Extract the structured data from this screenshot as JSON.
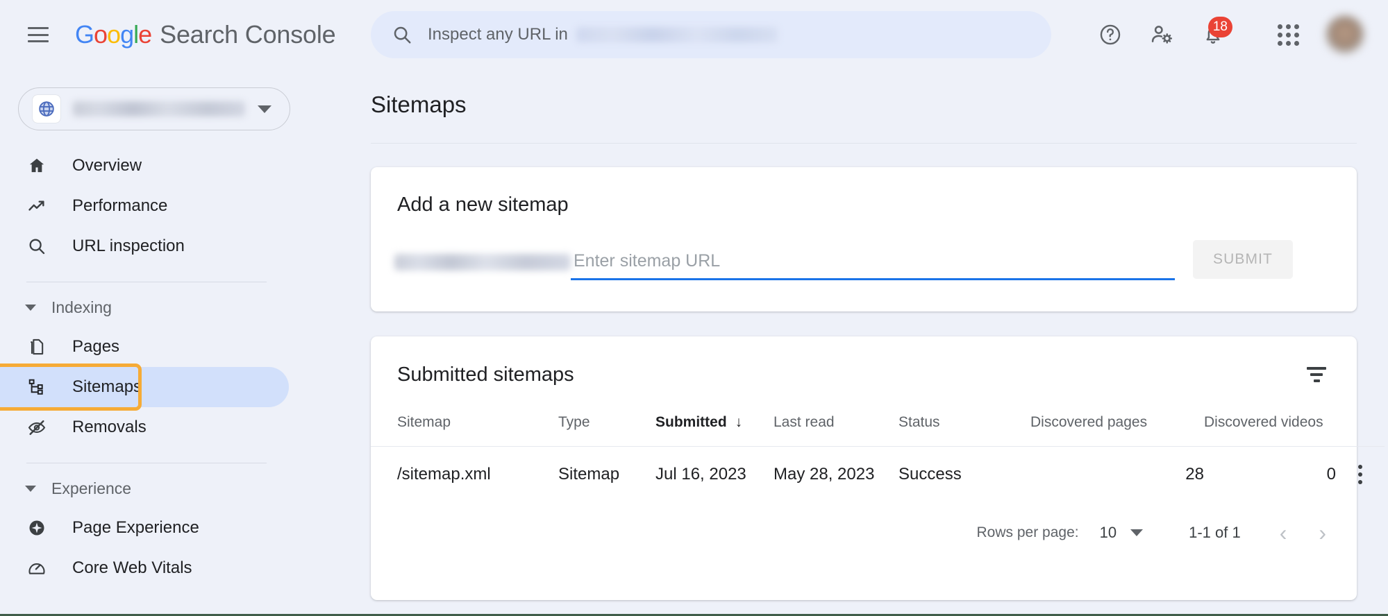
{
  "brand": {
    "logo_g1": "G",
    "logo_o1": "o",
    "logo_o2": "o",
    "logo_g2": "g",
    "logo_l": "l",
    "logo_e": "e",
    "product": "Search Console",
    "accent_blue": "#4285f4",
    "accent_red": "#ea4335",
    "accent_yellow": "#fbbc05",
    "accent_green": "#34a853"
  },
  "search": {
    "placeholder_prefix": "Inspect any URL in",
    "domain_redacted": true
  },
  "topbar_icons": {
    "help": "help-icon",
    "account_settings": "account-settings-icon",
    "notifications": "notifications-bell-icon",
    "notifications_count": "18",
    "apps": "apps-grid-icon",
    "avatar": "user-avatar"
  },
  "sidebar": {
    "property_selector": {
      "icon": "globe-icon",
      "value_redacted": true,
      "caret": "chevron-down-icon"
    },
    "primary_items": [
      {
        "label": "Overview",
        "icon": "home-icon"
      },
      {
        "label": "Performance",
        "icon": "trending-up-icon"
      },
      {
        "label": "URL inspection",
        "icon": "search-icon"
      }
    ],
    "sections": [
      {
        "label": "Indexing",
        "items": [
          {
            "label": "Pages",
            "icon": "pages-copy-icon",
            "selected": false
          },
          {
            "label": "Sitemaps",
            "icon": "sitemap-tree-icon",
            "selected": true,
            "highlighted": true
          },
          {
            "label": "Removals",
            "icon": "eye-off-icon",
            "selected": false
          }
        ]
      },
      {
        "label": "Experience",
        "items": [
          {
            "label": "Page Experience",
            "icon": "page-experience-icon",
            "selected": false
          },
          {
            "label": "Core Web Vitals",
            "icon": "speedometer-icon",
            "selected": false
          }
        ]
      }
    ],
    "highlight_color": "#f6ab36",
    "selected_bg": "#d2e0fb"
  },
  "main": {
    "page_title": "Sitemaps",
    "add_card": {
      "title": "Add a new sitemap",
      "url_prefix_redacted": true,
      "input_placeholder": "Enter sitemap URL",
      "input_value": "",
      "submit_label": "SUBMIT",
      "underline_color": "#1a73e8"
    },
    "table_card": {
      "title": "Submitted sitemaps",
      "filter_icon": "filter-icon",
      "columns": [
        {
          "label": "Sitemap",
          "align": "left",
          "sorted": false
        },
        {
          "label": "Type",
          "align": "left",
          "sorted": false
        },
        {
          "label": "Submitted",
          "align": "left",
          "sorted": true,
          "sort_arrow": "↓"
        },
        {
          "label": "Last read",
          "align": "left",
          "sorted": false
        },
        {
          "label": "Status",
          "align": "left",
          "sorted": false
        },
        {
          "label": "Discovered pages",
          "align": "right",
          "sorted": false
        },
        {
          "label": "Discovered videos",
          "align": "right",
          "sorted": false
        }
      ],
      "rows": [
        {
          "sitemap": "/sitemap.xml",
          "type": "Sitemap",
          "submitted": "Jul 16, 2023",
          "last_read": "May 28, 2023",
          "status": "Success",
          "status_color": "#188038",
          "discovered_pages": "28",
          "discovered_videos": "0",
          "menu": "more-options-icon"
        }
      ],
      "pagination": {
        "rows_per_page_label": "Rows per page:",
        "rows_per_page_value": "10",
        "range": "1-1 of 1",
        "prev": "‹",
        "next": "›"
      }
    }
  }
}
